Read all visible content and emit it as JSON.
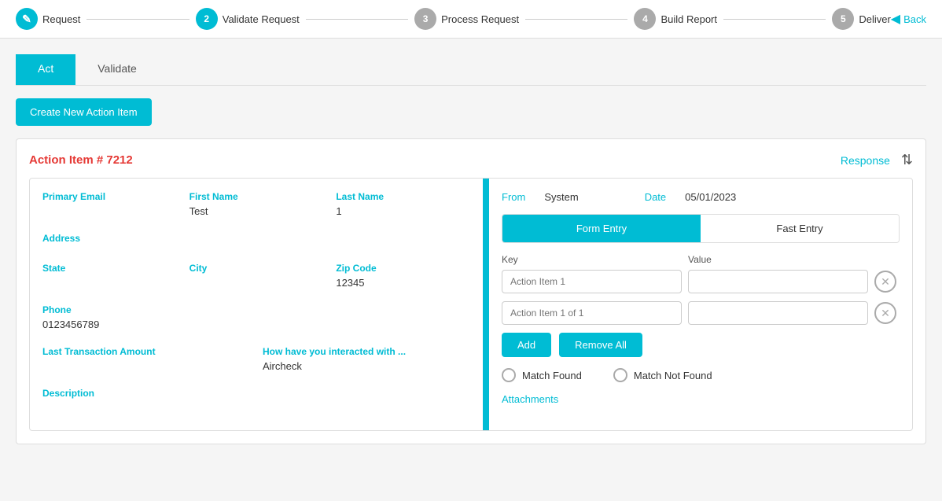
{
  "topNav": {
    "steps": [
      {
        "id": 1,
        "label": "Request",
        "type": "pencil",
        "active": true
      },
      {
        "id": 2,
        "label": "Validate Request",
        "type": "number",
        "active": true
      },
      {
        "id": 3,
        "label": "Process Request",
        "type": "number",
        "active": false
      },
      {
        "id": 4,
        "label": "Build Report",
        "type": "number",
        "active": false
      },
      {
        "id": 5,
        "label": "Deliver",
        "type": "number",
        "active": false
      }
    ],
    "back_label": "Back"
  },
  "tabs": {
    "act_label": "Act",
    "validate_label": "Validate"
  },
  "create_button_label": "Create New Action Item",
  "card": {
    "action_item_title": "Action Item # 7212",
    "response_label": "Response"
  },
  "left_panel": {
    "fields": [
      {
        "label": "Primary Email",
        "value": ""
      },
      {
        "label": "First Name",
        "value": "Test"
      },
      {
        "label": "Last Name",
        "value": "1"
      },
      {
        "label": "Address",
        "value": ""
      },
      {
        "label": "State",
        "value": ""
      },
      {
        "label": "City",
        "value": ""
      },
      {
        "label": "Zip Code",
        "value": "12345"
      },
      {
        "label": "Phone",
        "value": "0123456789"
      },
      {
        "label": "Last Transaction Amount",
        "value": ""
      },
      {
        "label": "How have you interacted with ...",
        "value": "Aircheck"
      },
      {
        "label": "Description",
        "value": ""
      }
    ]
  },
  "right_panel": {
    "from_label": "From",
    "from_value": "System",
    "date_label": "Date",
    "date_value": "05/01/2023",
    "form_entry_label": "Form Entry",
    "fast_entry_label": "Fast Entry",
    "key_header": "Key",
    "value_header": "Value",
    "kv_rows": [
      {
        "key_placeholder": "Action Item 1",
        "value_placeholder": ""
      },
      {
        "key_placeholder": "Action Item 1 of 1",
        "value_placeholder": ""
      }
    ],
    "add_label": "Add",
    "remove_all_label": "Remove All",
    "match_found_label": "Match Found",
    "match_not_found_label": "Match Not Found",
    "attachments_label": "Attachments"
  },
  "icons": {
    "pencil": "✎",
    "back_arrow": "◀",
    "chevron_updown": "⇅",
    "close_circle": "✕"
  }
}
